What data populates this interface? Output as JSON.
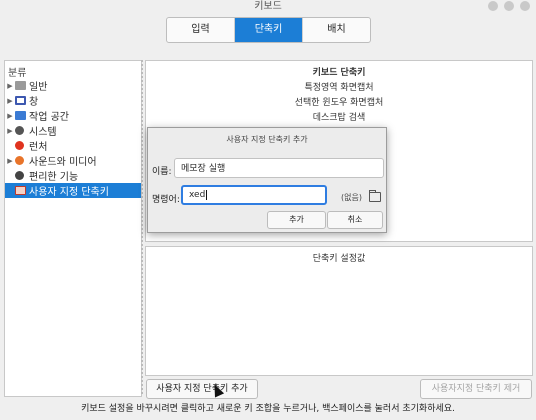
{
  "window": {
    "title": "키보드"
  },
  "tabs": [
    {
      "label": "입력",
      "active": false
    },
    {
      "label": "단축키",
      "active": true
    },
    {
      "label": "배치",
      "active": false
    }
  ],
  "sidebar": {
    "header": "분류",
    "items": [
      {
        "label": "일반",
        "icon": "window-icon",
        "expandable": true,
        "selected": false
      },
      {
        "label": "창",
        "icon": "window-frame-icon",
        "expandable": true,
        "selected": false
      },
      {
        "label": "작업 공간",
        "icon": "workspace-icon",
        "expandable": true,
        "selected": false
      },
      {
        "label": "시스템",
        "icon": "system-gear-icon",
        "expandable": true,
        "selected": false
      },
      {
        "label": "런처",
        "icon": "launcher-icon",
        "expandable": false,
        "selected": false
      },
      {
        "label": "사운드와 미디어",
        "icon": "sound-icon",
        "expandable": true,
        "selected": false
      },
      {
        "label": "편리한 기능",
        "icon": "accessibility-icon",
        "expandable": false,
        "selected": false
      },
      {
        "label": "사용자 지정 단축키",
        "icon": "custom-shortcut-icon",
        "expandable": false,
        "selected": true
      }
    ]
  },
  "shortcut_list": {
    "header": "키보드 단축키",
    "items": [
      "특정영역 화면캡처",
      "선택한 윈도우 화면캡처",
      "데스크탑 검색"
    ]
  },
  "shortcut_settings": {
    "header": "단축키 설정값"
  },
  "buttons": {
    "add_custom": "사용자 지정 단축키 추가",
    "remove_custom": "사용자지정 단축키 제거"
  },
  "footer_hint": "키보드 설정을 바꾸시려면 클릭하고 새로운 키 조합을 누르거나, 백스페이스를 눌러서 초기화하세요.",
  "dialog": {
    "title": "사용자 지정 단축키 추가",
    "name_label": "이름:",
    "name_value": "메모장 실행",
    "command_label": "명령어:",
    "command_value": "xed",
    "command_none": "(없음)",
    "add_button": "추가",
    "cancel_button": "취소"
  },
  "colors": {
    "accent": "#1c7ed6",
    "focus": "#2f7de1"
  }
}
